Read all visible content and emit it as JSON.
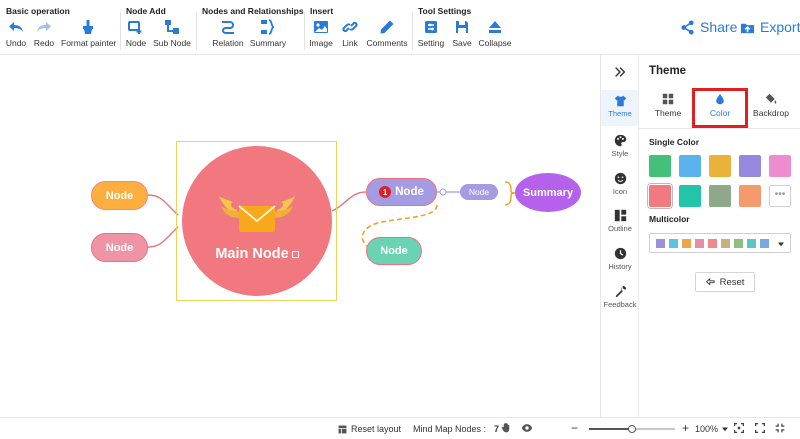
{
  "toolbar": {
    "groups": [
      {
        "title": "Basic operation",
        "tools": [
          {
            "label": "Undo",
            "icon": "undo-icon"
          },
          {
            "label": "Redo",
            "icon": "redo-icon"
          },
          {
            "label": "Format painter",
            "icon": "format-painter-icon"
          }
        ]
      },
      {
        "title": "Node Add",
        "tools": [
          {
            "label": "Node",
            "icon": "add-node-icon"
          },
          {
            "label": "Sub Node",
            "icon": "add-subnode-icon"
          }
        ]
      },
      {
        "title": "Nodes and Relationships",
        "tools": [
          {
            "label": "Relation",
            "icon": "relation-icon"
          },
          {
            "label": "Summary",
            "icon": "summary-icon"
          }
        ]
      },
      {
        "title": "Insert",
        "tools": [
          {
            "label": "Image",
            "icon": "image-icon"
          },
          {
            "label": "Link",
            "icon": "link-icon"
          },
          {
            "label": "Comments",
            "icon": "comments-icon"
          }
        ]
      },
      {
        "title": "Tool Settings",
        "tools": [
          {
            "label": "Setting",
            "icon": "setting-icon"
          },
          {
            "label": "Save",
            "icon": "save-icon"
          },
          {
            "label": "Collapse",
            "icon": "collapse-icon"
          }
        ]
      }
    ],
    "share_label": "Share",
    "export_label": "Export"
  },
  "colors": {
    "accent": "#2a7ad8",
    "highlight_border": "#e02020"
  },
  "mindmap": {
    "main_label": "Main Node",
    "left_node_1": "Node",
    "left_node_2": "Node",
    "right_node": "Node",
    "right_node_badge": "1",
    "child_node": "Node",
    "sub_node": "Node",
    "summary_label": "Summary"
  },
  "side_tabs": [
    {
      "label": "Theme",
      "icon": "shirt-icon",
      "active": true
    },
    {
      "label": "Style",
      "icon": "palette-icon"
    },
    {
      "label": "Icon",
      "icon": "smiley-icon"
    },
    {
      "label": "Outline",
      "icon": "outline-icon"
    },
    {
      "label": "History",
      "icon": "clock-icon"
    },
    {
      "label": "Feedback",
      "icon": "wrench-icon"
    }
  ],
  "panel": {
    "title": "Theme",
    "tabs": [
      {
        "label": "Theme",
        "icon": "grid-icon"
      },
      {
        "label": "Color",
        "icon": "drop-icon",
        "active": true
      },
      {
        "label": "Backdrop",
        "icon": "paint-bucket-icon"
      }
    ],
    "single_color_title": "Single Color",
    "single_colors": [
      "#44c07a",
      "#5ab3ec",
      "#eab23a",
      "#9688de",
      "#ee8cd0",
      "#f07a80",
      "#22c5a8",
      "#8fa889",
      "#f59a6c"
    ],
    "multicolor_title": "Multicolor",
    "multicolors": [
      "#9b8fd9",
      "#5fc3e0",
      "#e9a84a",
      "#e88aa8",
      "#f08a8a",
      "#c5b27a",
      "#8fbf7f",
      "#5ac8c0",
      "#78a8e0"
    ],
    "reset_label": "Reset"
  },
  "status": {
    "reset_layout": "Reset layout",
    "nodes_label": "Mind Map Nodes :",
    "nodes_count": "7",
    "zoom_minus": "−",
    "zoom_plus": "+",
    "zoom_level": "100%",
    "zoom_fraction": 0.5
  }
}
